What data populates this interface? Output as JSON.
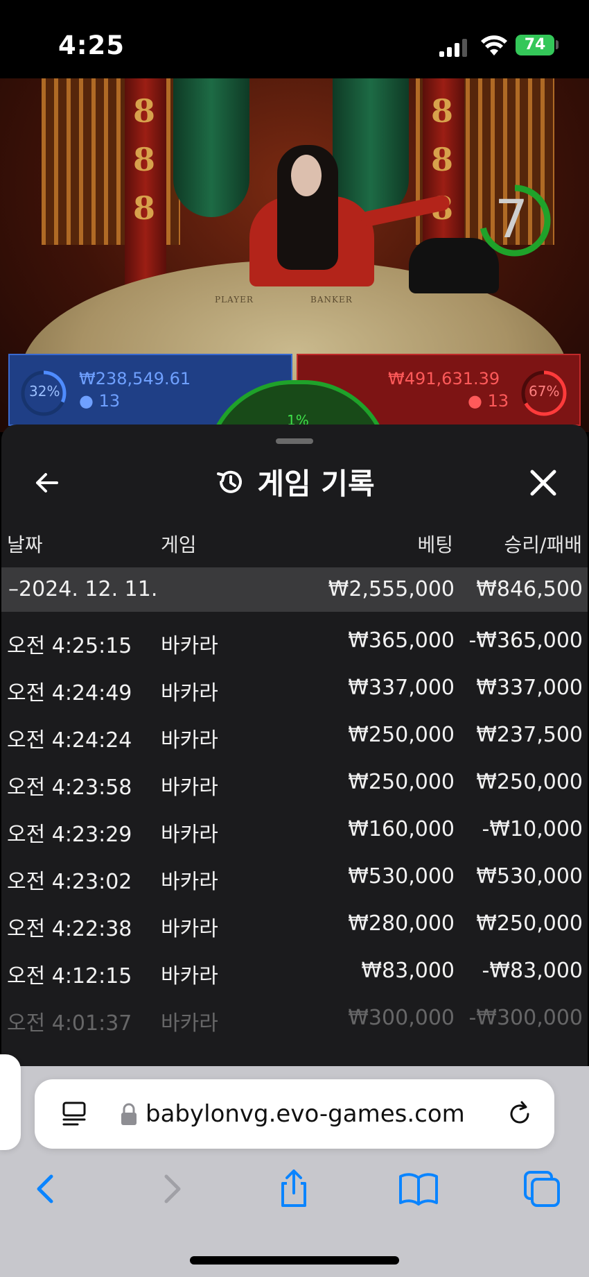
{
  "status_bar": {
    "time": "4:25",
    "battery": "74"
  },
  "video": {
    "countdown": "7",
    "felt_left": "PLAYER",
    "felt_right": "BANKER",
    "player": {
      "percent": "32%",
      "amount": "₩238,549.61",
      "players": "13"
    },
    "banker": {
      "percent": "67%",
      "amount": "₩491,631.39",
      "players": "13"
    },
    "tie": {
      "percent": "1%"
    }
  },
  "panel": {
    "title": "게임 기록",
    "columns": {
      "date": "날짜",
      "game": "게임",
      "bet": "베팅",
      "winloss": "승리/패배"
    },
    "date_group": {
      "label": "–2024. 12. 11.",
      "bet_total": "₩2,555,000",
      "winloss_total": "₩846,500"
    },
    "rows": [
      {
        "time": "오전 4:25:15",
        "game": "바카라",
        "bet": "₩365,000",
        "winloss": "-₩365,000"
      },
      {
        "time": "오전 4:24:49",
        "game": "바카라",
        "bet": "₩337,000",
        "winloss": "₩337,000"
      },
      {
        "time": "오전 4:24:24",
        "game": "바카라",
        "bet": "₩250,000",
        "winloss": "₩237,500"
      },
      {
        "time": "오전 4:23:58",
        "game": "바카라",
        "bet": "₩250,000",
        "winloss": "₩250,000"
      },
      {
        "time": "오전 4:23:29",
        "game": "바카라",
        "bet": "₩160,000",
        "winloss": "-₩10,000"
      },
      {
        "time": "오전 4:23:02",
        "game": "바카라",
        "bet": "₩530,000",
        "winloss": "₩530,000"
      },
      {
        "time": "오전 4:22:38",
        "game": "바카라",
        "bet": "₩280,000",
        "winloss": "₩250,000"
      },
      {
        "time": "오전 4:12:15",
        "game": "바카라",
        "bet": "₩83,000",
        "winloss": "-₩83,000"
      },
      {
        "time": "오전 4:01:37",
        "game": "바카라",
        "bet": "₩300,000",
        "winloss": "-₩300,000"
      }
    ]
  },
  "browser": {
    "url": "babylonvg.evo-games.com"
  },
  "colors": {
    "player_blue": "#3a6ad0",
    "banker_red": "#c02a2a",
    "tie_green": "#1fa22a",
    "panel_bg": "#1b1b1d",
    "link_blue": "#0a84ff"
  }
}
